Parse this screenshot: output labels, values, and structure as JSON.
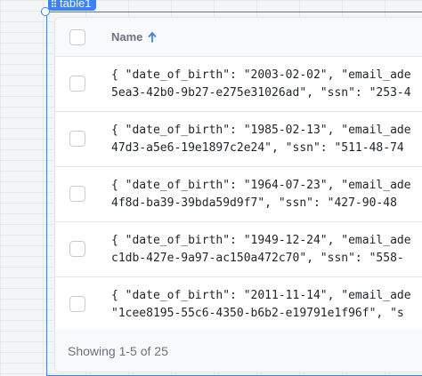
{
  "widget": {
    "name": "table1"
  },
  "table": {
    "columns": [
      {
        "label": "Name",
        "sort": "ascending"
      }
    ],
    "rows": [
      {
        "line1": "{ \"date_of_birth\": \"2003-02-02\", \"email_ade",
        "line2": "5ea3-42b0-9b27-e275e31026ad\", \"ssn\": \"253-4"
      },
      {
        "line1": "{ \"date_of_birth\": \"1985-02-13\", \"email_ade",
        "line2": "47d3-a5e6-19e1897c2e24\", \"ssn\": \"511-48-74"
      },
      {
        "line1": "{ \"date_of_birth\": \"1964-07-23\", \"email_ade",
        "line2": "4f8d-ba39-39bda59d9f7\", \"ssn\": \"427-90-48"
      },
      {
        "line1": "{ \"date_of_birth\": \"1949-12-24\", \"email_ade",
        "line2": "c1db-427e-9a97-ac150a472c70\", \"ssn\": \"558-"
      },
      {
        "line1": "{ \"date_of_birth\": \"2011-11-14\", \"email_ade",
        "line2": "\"1cee8195-55c6-4350-b6b2-e19791e1f96f\", \"s"
      }
    ],
    "footer": "Showing 1-5 of 25"
  },
  "colors": {
    "selection": "#3b82f6",
    "header_text": "#6b7280"
  }
}
